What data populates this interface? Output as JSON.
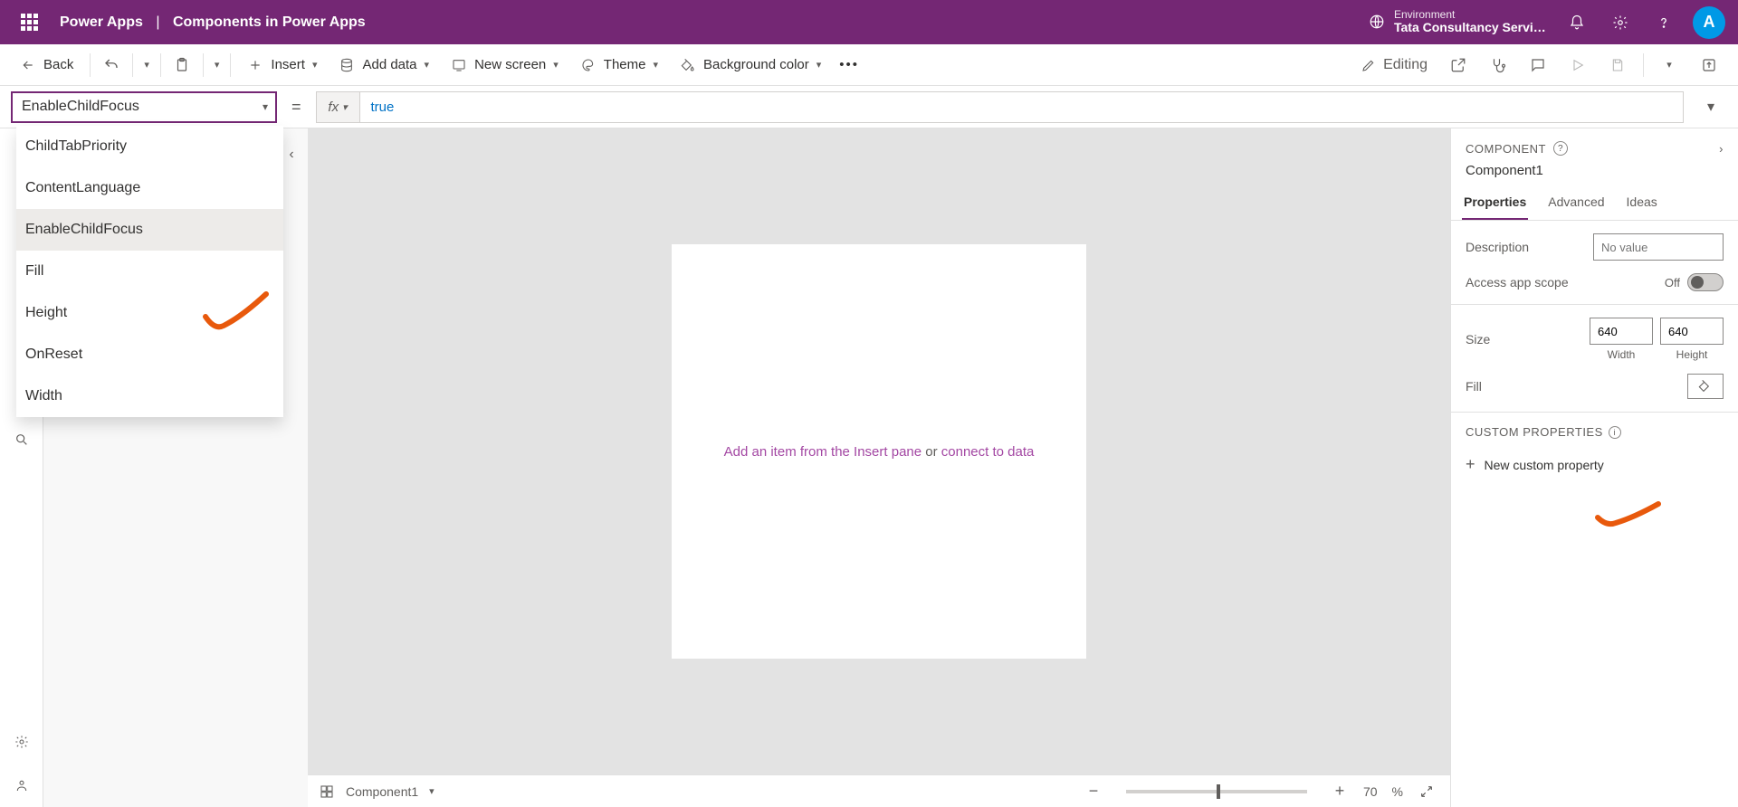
{
  "header": {
    "brand": "Power Apps",
    "separator": "|",
    "app_name": "Components in Power Apps",
    "environment_label": "Environment",
    "environment_name": "Tata Consultancy Servic...",
    "avatar_initial": "A"
  },
  "cmdbar": {
    "back": "Back",
    "insert": "Insert",
    "add_data": "Add data",
    "new_screen": "New screen",
    "theme": "Theme",
    "bg_color": "Background color",
    "editing": "Editing"
  },
  "formula": {
    "selected_property": "EnableChildFocus",
    "equals": "=",
    "fx_label": "fx",
    "value": "true"
  },
  "property_dropdown": {
    "items": [
      "ChildTabPriority",
      "ContentLanguage",
      "EnableChildFocus",
      "Fill",
      "Height",
      "OnReset",
      "Width"
    ]
  },
  "canvas": {
    "hint_prefix": "Add an item from the Insert pane",
    "hint_or": " or ",
    "hint_link": "connect to data"
  },
  "statusbar": {
    "component_label": "Component1",
    "zoom_value": "70",
    "zoom_unit": "%"
  },
  "props": {
    "section_label": "COMPONENT",
    "name": "Component1",
    "tabs": {
      "properties": "Properties",
      "advanced": "Advanced",
      "ideas": "Ideas"
    },
    "description_label": "Description",
    "description_placeholder": "No value",
    "access_scope_label": "Access app scope",
    "access_scope_value": "Off",
    "size_label": "Size",
    "width_value": "640",
    "height_value": "640",
    "width_label": "Width",
    "height_label": "Height",
    "fill_label": "Fill",
    "custom_header": "CUSTOM PROPERTIES",
    "new_custom": "New custom property"
  }
}
